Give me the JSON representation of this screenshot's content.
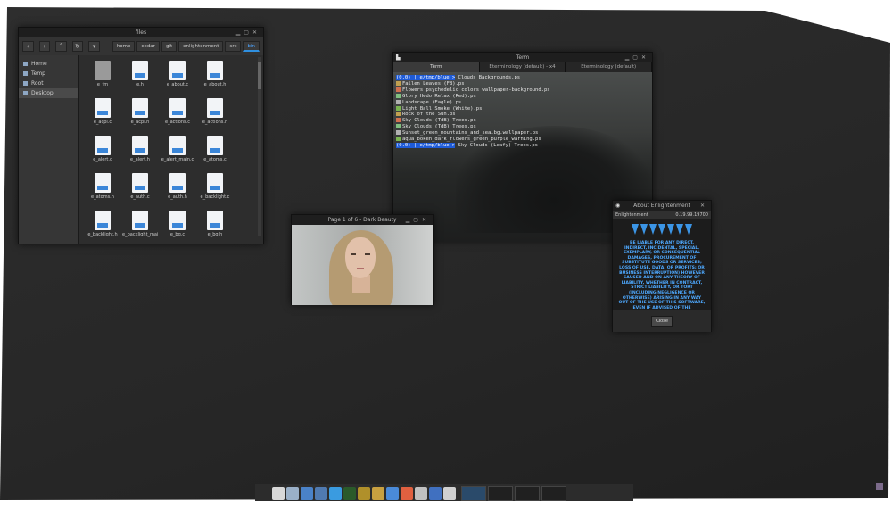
{
  "file_manager": {
    "title": "files",
    "breadcrumbs": [
      "home",
      "cedar",
      "git",
      "enlightenment",
      "src",
      "bin"
    ],
    "sidebar": [
      "Home",
      "Temp",
      "Root",
      "Desktop"
    ],
    "files": [
      "e_fm",
      "e.h",
      "e_about.c",
      "e_about.h",
      "e_acpi.c",
      "e_acpi.h",
      "e_actions.c",
      "e_actions.h",
      "e_alert.c",
      "e_alert.h",
      "e_alert_main.c",
      "e_atoms.c",
      "e_atoms.h",
      "e_auth.c",
      "e_auth.h",
      "e_backlight.c",
      "e_backlight.h",
      "e_backlight_main.c",
      "e_bg.c",
      "e_bg.h"
    ]
  },
  "terminal": {
    "title": "Term",
    "tabs": [
      "Term",
      "Eterminology (default) - x4",
      "Eterminology (default)"
    ],
    "prompt": "(0.0) | e/tmp/blue >",
    "lines": [
      {
        "p": true,
        "t": "Clouds Backgrounds.ps"
      },
      {
        "p": false,
        "t": "Fallen Leaves (F8).ps"
      },
      {
        "p": false,
        "t": "Flowers psychedelic colors wallpaper-background.ps"
      },
      {
        "p": false,
        "t": "Glory Hedo Relax (Red).ps"
      },
      {
        "p": false,
        "t": "Landscape (Eagle).ps"
      },
      {
        "p": false,
        "t": "Light Ball Smoke (White).ps"
      },
      {
        "p": false,
        "t": "Rock of the Sun.ps"
      },
      {
        "p": false,
        "t": "Sky Clouds (TdB) Trees.ps"
      },
      {
        "p": false,
        "t": "Sky Clouds (TdB) Trees.ps"
      },
      {
        "p": false,
        "t": "Sunset_green_mountains_and_sea.bg.wallpaper.ps"
      },
      {
        "p": false,
        "t": "aqua_bokeh_dark_flowers_green_purple_warning.ps"
      },
      {
        "p": true,
        "t": "Sky Clouds (Leafy) Trees.ps"
      }
    ]
  },
  "image_viewer": {
    "title": "Page 1 of 6 - Dark Beauty"
  },
  "about": {
    "title": "About Enlightenment",
    "name": "Enlightenment",
    "version": "0.19.99.19700",
    "text": "BE LIABLE FOR ANY DIRECT, INDIRECT, INCIDENTAL, SPECIAL, EXEMPLARY, OR CONSEQUENTIAL DAMAGES, PROCUREMENT OF SUBSTITUTE GOODS OR SERVICES; LOSS OF USE, DATA, OR PROFITS; OR BUSINESS INTERRUPTION) HOWEVER CAUSED AND ON ANY THEORY OF LIABILITY, WHETHER IN CONTRACT, STRICT LIABILITY, OR TORT (INCLUDING NEGLIGENCE OR OTHERWISE) ARISING IN ANY WAY OUT OF THE USE OF THIS SOFTWARE, EVEN IF ADVISED OF THE POSSIBILITY OF SUCH DAMAGE.",
    "close_label": "Close"
  },
  "shelf": {
    "icons": [
      "up-arrow-icon",
      "computer-icon",
      "folder-icon",
      "browser-icon",
      "monitor-icon",
      "telegram-icon",
      "terminal-icon",
      "image-icon",
      "paint-icon",
      "photos-icon",
      "chat-icon",
      "mail-icon",
      "settings-icon",
      "clipboard-icon"
    ],
    "icon_colors": [
      "#2c2c2c",
      "#d8d8d8",
      "#9ab0c8",
      "#4a82c8",
      "#507ab0",
      "#3a9be0",
      "#2a5a2a",
      "#b0902a",
      "#c8a040",
      "#4a8ad8",
      "#e06040",
      "#c0c0c0",
      "#4070c0",
      "#d0d0d0"
    ]
  },
  "colors": {
    "accent": "#2f8fdf",
    "prompt_bg": "#1e5bd8",
    "about_text": "#4ea9ff"
  }
}
